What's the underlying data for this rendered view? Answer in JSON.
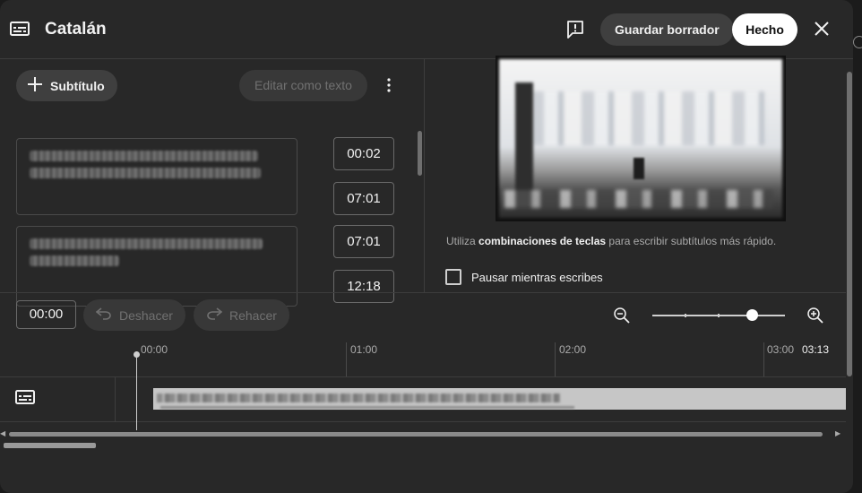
{
  "header": {
    "title": "Catalán",
    "save_draft_label": "Guardar borrador",
    "done_label": "Hecho"
  },
  "editor": {
    "add_subtitle_label": "Subtítulo",
    "edit_as_text_label": "Editar como texto",
    "cues": [
      {
        "start": "00:02",
        "end": "07:01"
      },
      {
        "start": "07:01",
        "end": "12:18"
      }
    ]
  },
  "preview": {
    "tip_prefix": "Utiliza ",
    "tip_bold": "combinaciones de teclas",
    "tip_suffix": " para escribir subtítulos más rápido.",
    "pause_label": "Pausar mientras escribes",
    "pause_checked": false
  },
  "toolbar": {
    "current_time": "00:00",
    "undo_label": "Deshacer",
    "redo_label": "Rehacer",
    "zoom_level": 0.75
  },
  "timeline": {
    "ruler": [
      "00:00",
      "01:00",
      "02:00",
      "03:00"
    ],
    "duration": "03:13"
  },
  "colors": {
    "background": "#282828",
    "button": "#3f3f3f",
    "primary_button": "#ffffff",
    "clip": "#c6c6c6"
  }
}
